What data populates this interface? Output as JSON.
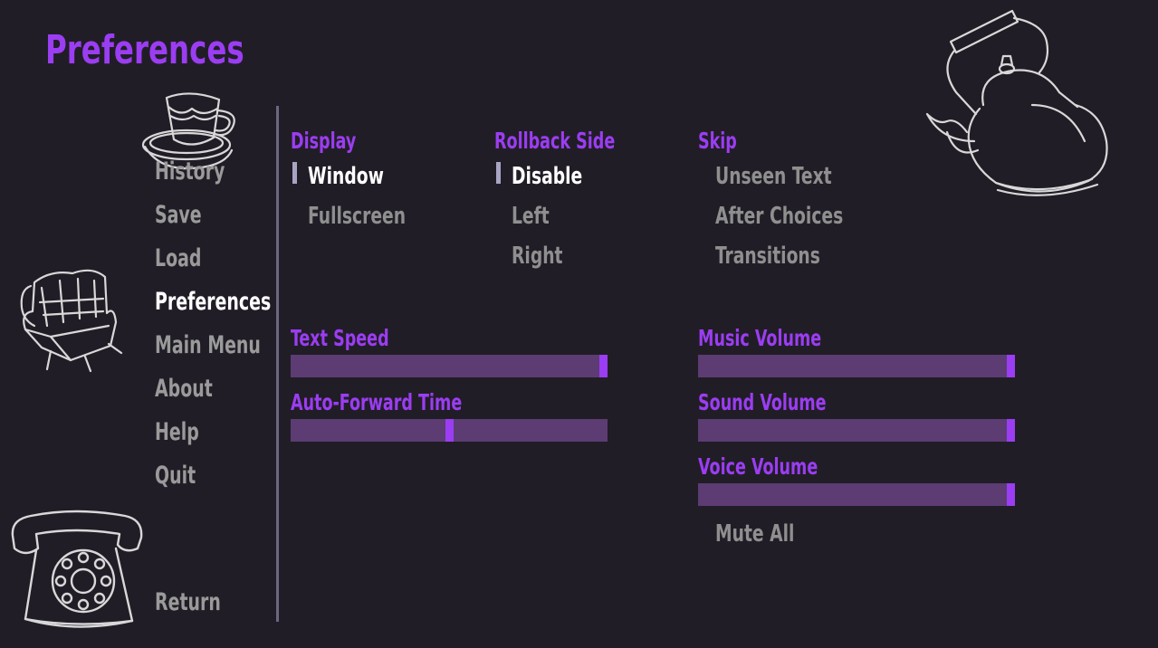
{
  "title": "Preferences",
  "colors": {
    "accent": "#9b3df2",
    "background": "#211d26",
    "inactive_text": "#9a9a9a",
    "active_text": "#ffffff",
    "slider_track": "#5c3c73"
  },
  "nav": {
    "items": [
      {
        "label": "History",
        "active": false
      },
      {
        "label": "Save",
        "active": false
      },
      {
        "label": "Load",
        "active": false
      },
      {
        "label": "Preferences",
        "active": true
      },
      {
        "label": "Main Menu",
        "active": false
      },
      {
        "label": "About",
        "active": false
      },
      {
        "label": "Help",
        "active": false
      },
      {
        "label": "Quit",
        "active": false
      }
    ],
    "return_label": "Return"
  },
  "display": {
    "label": "Display",
    "options": [
      "Window",
      "Fullscreen"
    ],
    "selected": "Window"
  },
  "rollback": {
    "label": "Rollback Side",
    "options": [
      "Disable",
      "Left",
      "Right"
    ],
    "selected": "Disable"
  },
  "skip": {
    "label": "Skip",
    "options": [
      "Unseen Text",
      "After Choices",
      "Transitions"
    ]
  },
  "sliders": {
    "text_speed": {
      "label": "Text Speed",
      "value": 1.0
    },
    "auto_forward": {
      "label": "Auto-Forward Time",
      "value": 0.5
    },
    "music_volume": {
      "label": "Music Volume",
      "value": 1.0
    },
    "sound_volume": {
      "label": "Sound Volume",
      "value": 1.0
    },
    "voice_volume": {
      "label": "Voice Volume",
      "value": 1.0
    }
  },
  "mute_all_label": "Mute All",
  "icons": [
    "teacup-icon",
    "armchair-icon",
    "telephone-icon",
    "kettle-icon"
  ]
}
